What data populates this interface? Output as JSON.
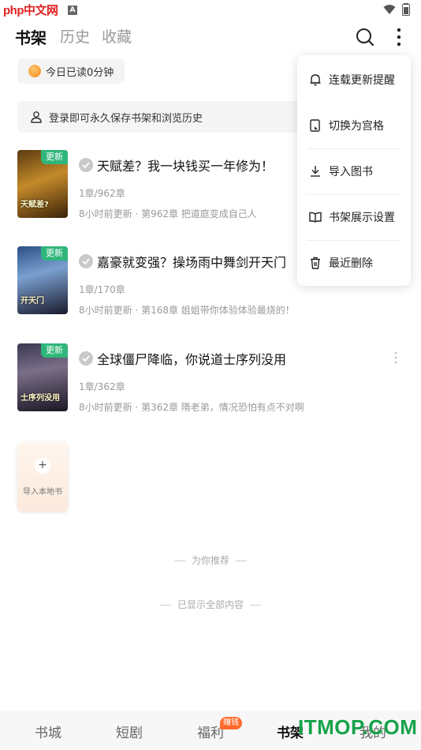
{
  "status_bar": {
    "watermark_logo": "php中文网"
  },
  "header": {
    "tabs": [
      {
        "label": "书架",
        "active": true
      },
      {
        "label": "历史",
        "active": false
      },
      {
        "label": "收藏",
        "active": false
      }
    ]
  },
  "reading": {
    "today_text": "今日已读0分钟"
  },
  "login_banner": {
    "text": "登录即可永久保存书架和浏览历史"
  },
  "books": [
    {
      "badge": "更新",
      "cover_title": "天赋差?",
      "title": "天赋差？我一块钱买一年修为！",
      "progress": "1章/962章",
      "update": "8小时前更新 · 第962章 把道庭变成自己人"
    },
    {
      "badge": "更新",
      "cover_title": "开天门",
      "title": "嘉豪就变强？操场雨中舞剑开天门",
      "progress": "1章/170章",
      "update": "8小时前更新 · 第168章 姐姐带你体验体验最烧的！"
    },
    {
      "badge": "更新",
      "cover_title": "士序列没用",
      "title": "全球僵尸降临，你说道士序列没用",
      "progress": "1章/362章",
      "update": "8小时前更新 · 第362章 隋老弟，情况恐怕有点不对啊"
    }
  ],
  "import_local": {
    "plus": "+",
    "label": "导入本地书"
  },
  "recommend_divider": "为你推荐",
  "end_divider": "已显示全部内容",
  "menu": {
    "items": [
      {
        "label": "连载更新提醒",
        "icon": "bell-icon"
      },
      {
        "label": "切换为宫格",
        "icon": "grid-switch-icon"
      },
      {
        "label": "导入图书",
        "icon": "download-icon"
      },
      {
        "label": "书架展示设置",
        "icon": "book-open-icon"
      },
      {
        "label": "最近删除",
        "icon": "trash-icon"
      }
    ]
  },
  "bottom_nav": {
    "items": [
      {
        "label": "书城",
        "active": false
      },
      {
        "label": "短剧",
        "active": false
      },
      {
        "label": "福利",
        "active": false
      },
      {
        "label": "书架",
        "active": true
      },
      {
        "label": "我的",
        "active": false
      }
    ],
    "welfare_badge": "赚钱",
    "watermark": "ITMOP.COM"
  },
  "colors": {
    "accent_green": "#2fb67a",
    "earn_orange": "#ff6a2c",
    "watermark_green": "#16a34a"
  }
}
